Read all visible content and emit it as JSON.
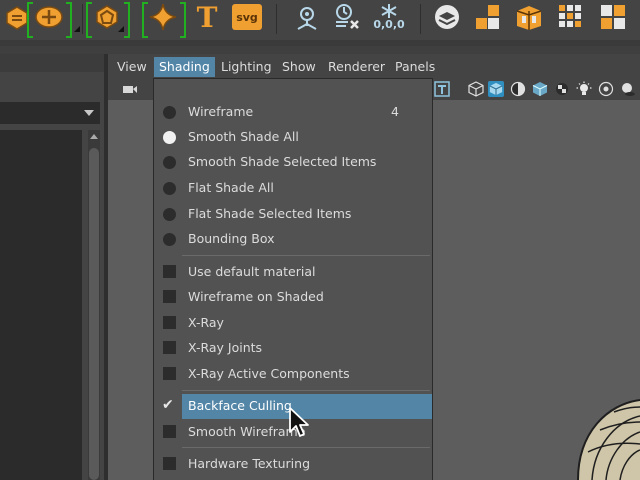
{
  "menubar": {
    "items": [
      {
        "label": "View",
        "active": false
      },
      {
        "label": "Shading",
        "active": true
      },
      {
        "label": "Lighting",
        "active": false
      },
      {
        "label": "Show",
        "active": false
      },
      {
        "label": "Renderer",
        "active": false
      },
      {
        "label": "Panels",
        "active": false
      }
    ]
  },
  "shelf": {
    "text_tool_label": "T",
    "svg_tool_label": "svg",
    "coords_label": "0,0,0"
  },
  "shading_menu": {
    "items": [
      {
        "label": "Wireframe",
        "shortcut": "4",
        "kind": "radio",
        "checked": false
      },
      {
        "label": "Smooth Shade All",
        "shortcut": "",
        "kind": "radio",
        "checked": true
      },
      {
        "label": "Smooth Shade Selected Items",
        "shortcut": "",
        "kind": "radio",
        "checked": false
      },
      {
        "label": "Flat Shade All",
        "shortcut": "",
        "kind": "radio",
        "checked": false
      },
      {
        "label": "Flat Shade Selected Items",
        "shortcut": "",
        "kind": "radio",
        "checked": false
      },
      {
        "label": "Bounding Box",
        "shortcut": "",
        "kind": "radio",
        "checked": false
      },
      {
        "label": "Use default material",
        "shortcut": "",
        "kind": "check",
        "checked": false
      },
      {
        "label": "Wireframe on Shaded",
        "shortcut": "",
        "kind": "check",
        "checked": false
      },
      {
        "label": "X-Ray",
        "shortcut": "",
        "kind": "check",
        "checked": false
      },
      {
        "label": "X-Ray Joints",
        "shortcut": "",
        "kind": "check",
        "checked": false
      },
      {
        "label": "X-Ray Active Components",
        "shortcut": "",
        "kind": "check",
        "checked": false
      },
      {
        "label": "Backface Culling",
        "shortcut": "",
        "kind": "check",
        "checked": true,
        "highlighted": true
      },
      {
        "label": "Smooth Wireframe",
        "shortcut": "",
        "kind": "check",
        "checked": false
      },
      {
        "label": "Hardware Texturing",
        "shortcut": "",
        "kind": "check",
        "checked": false
      }
    ]
  },
  "colors": {
    "menu_bg": "#525252",
    "highlight": "#5285a6",
    "shelf_accent": "#f0a030",
    "selection_bracket": "#20b020"
  }
}
